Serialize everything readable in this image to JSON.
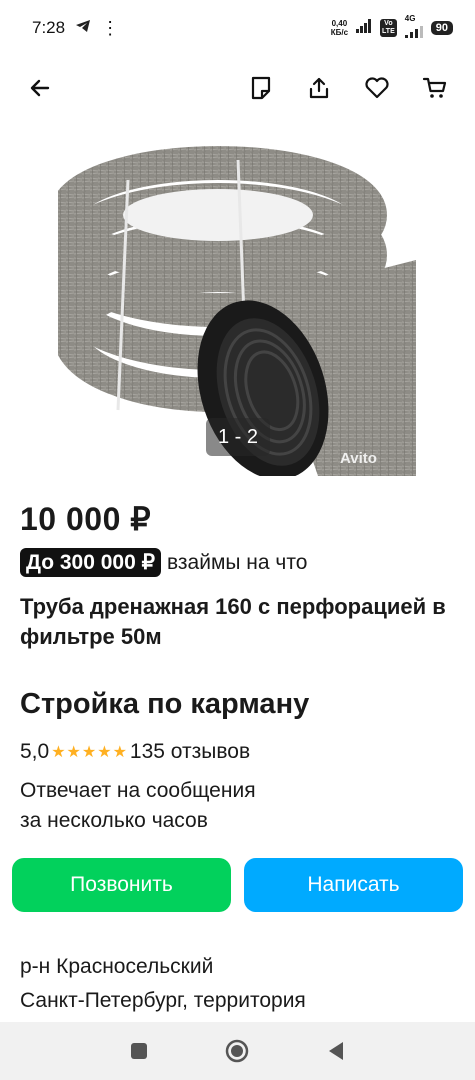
{
  "status_bar": {
    "time": "7:28",
    "net_speed_value": "0,40",
    "net_speed_unit": "КБ/с",
    "volte_top": "Vo",
    "volte_bottom": "LTE",
    "network": "4G",
    "battery": "90"
  },
  "toolbar": {
    "icons": [
      "back-arrow-icon",
      "note-icon",
      "share-icon",
      "heart-icon",
      "cart-icon"
    ]
  },
  "gallery": {
    "counter": "1 - 2",
    "watermark": "Avito"
  },
  "listing": {
    "price": "10 000 ₽",
    "loan_badge": "До 300 000 ₽",
    "loan_text": "взаймы на что",
    "title": "Труба дренажная 160 с перфорацией в фильтре 50м"
  },
  "seller": {
    "name": "Стройка по карману",
    "rating": "5,0",
    "stars": "★★★★★",
    "reviews": "135 отзывов",
    "response_line1": "Отвечает на сообщения",
    "response_line2": "за несколько часов"
  },
  "actions": {
    "call_label": "Позвонить",
    "write_label": "Написать"
  },
  "address": {
    "line1": "р-н Красносельский",
    "line2": "Санкт-Петербург, территория"
  },
  "colors": {
    "call_button": "#02d15c",
    "write_button": "#00aaff",
    "stars": "#ffb021"
  }
}
